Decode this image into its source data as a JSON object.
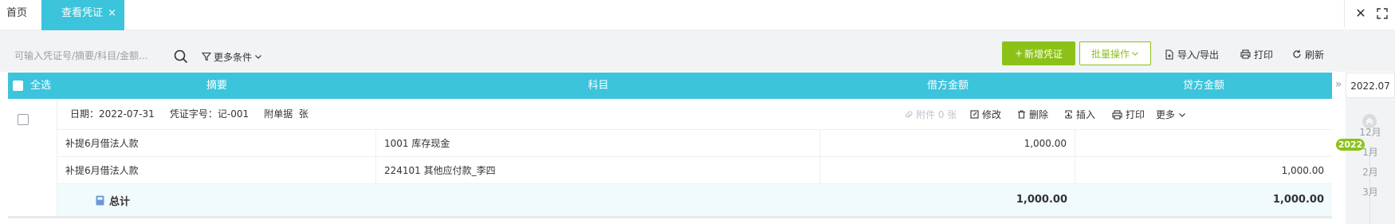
{
  "tabs": {
    "home_label": "首页",
    "active_label": "查看凭证",
    "active_close": "×"
  },
  "window": {
    "close_glyph": "✕",
    "fullscreen_glyph": "⛶"
  },
  "toolbar": {
    "search_placeholder": "可输入凭证号/摘要/科目/金额...",
    "more_conditions": "更多条件",
    "new_voucher": "新增凭证",
    "batch_ops": "批量操作",
    "import_export": "导入/导出",
    "print": "打印",
    "refresh": "刷新"
  },
  "table": {
    "select_all": "全选",
    "columns": [
      "摘要",
      "科目",
      "借方金额",
      "贷方金额"
    ]
  },
  "voucher": {
    "date_label": "日期：",
    "date": "2022-07-31",
    "number_label": "凭证字号：",
    "number": "记-001",
    "attachment_label": "附单据",
    "attachment_unit": "张",
    "actions": {
      "attachment": "附件 0 张",
      "edit": "修改",
      "delete": "删除",
      "insert": "插入",
      "print": "打印",
      "more": "更多"
    },
    "entries": [
      {
        "summary": "补提6月借法人款",
        "subject": "1001 库存现金",
        "debit": "1,000.00",
        "credit": ""
      },
      {
        "summary": "补提6月借法人款",
        "subject": "224101 其他应付款_李四",
        "debit": "",
        "credit": "1,000.00"
      }
    ],
    "total_label": "总计",
    "total_debit": "1,000.00",
    "total_credit": "1,000.00"
  },
  "period": {
    "current": "2022.07",
    "collapse_glyph": "»",
    "year_badge": "2022",
    "months": [
      "12月",
      "1月",
      "2月",
      "3月"
    ]
  },
  "colors": {
    "accent_cyan": "#3bc4dc",
    "accent_green": "#8cc218"
  }
}
